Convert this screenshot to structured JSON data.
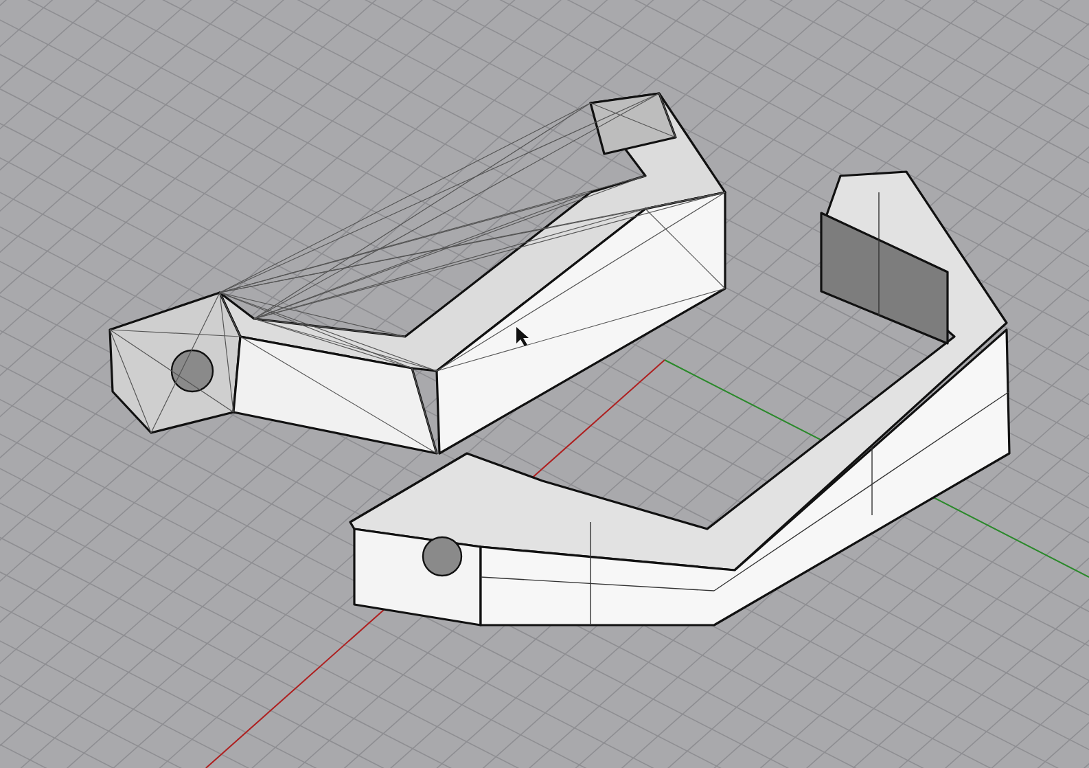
{
  "viewport": {
    "models": [
      {
        "kind": "mesh"
      },
      {
        "kind": "surface"
      }
    ]
  }
}
